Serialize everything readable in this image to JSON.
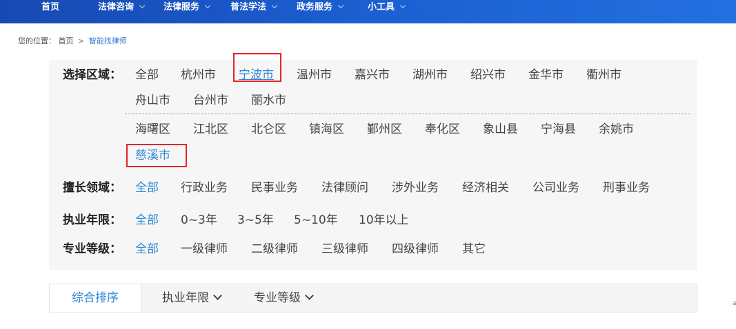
{
  "nav": {
    "items": [
      {
        "label": "首页",
        "has_dropdown": false
      },
      {
        "label": "法律咨询",
        "has_dropdown": true
      },
      {
        "label": "法律服务",
        "has_dropdown": true
      },
      {
        "label": "普法学法",
        "has_dropdown": true
      },
      {
        "label": "政务服务",
        "has_dropdown": true
      },
      {
        "label": "小工具",
        "has_dropdown": true
      }
    ]
  },
  "breadcrumb": {
    "prefix": "您的位置：",
    "home": "首页",
    "separator": ">",
    "current": "智能找律师"
  },
  "filters": {
    "region": {
      "label": "选择区域：",
      "cities": [
        "全部",
        "杭州市",
        "宁波市",
        "温州市",
        "嘉兴市",
        "湖州市",
        "绍兴市",
        "金华市",
        "衢州市",
        "舟山市",
        "台州市",
        "丽水市"
      ],
      "selected_city": "宁波市",
      "districts": [
        "海曙区",
        "江北区",
        "北仑区",
        "镇海区",
        "鄞州区",
        "奉化区",
        "象山县",
        "宁海县",
        "余姚市",
        "慈溪市"
      ],
      "selected_district": "慈溪市"
    },
    "expertise": {
      "label": "擅长领域：",
      "options": [
        "全部",
        "行政业务",
        "民事业务",
        "法律顾问",
        "涉外业务",
        "经济相关",
        "公司业务",
        "刑事业务"
      ],
      "selected": "全部"
    },
    "years": {
      "label": "执业年限：",
      "options": [
        "全部",
        "0~3年",
        "3~5年",
        "5~10年",
        "10年以上"
      ],
      "selected": "全部"
    },
    "level": {
      "label": "专业等级：",
      "options": [
        "全部",
        "一级律师",
        "二级律师",
        "三级律师",
        "四级律师",
        "其它"
      ],
      "selected": "全部"
    }
  },
  "sortbar": {
    "tabs": [
      {
        "label": "综合排序",
        "active": true,
        "has_dropdown": false
      },
      {
        "label": "执业年限",
        "active": false,
        "has_dropdown": true
      },
      {
        "label": "专业等级",
        "active": false,
        "has_dropdown": true
      }
    ]
  },
  "colors": {
    "nav_bg": "#1b5fd1",
    "accent": "#2f86d8",
    "highlight_box": "#e0262b",
    "panel_bg": "#f6f6f6"
  }
}
